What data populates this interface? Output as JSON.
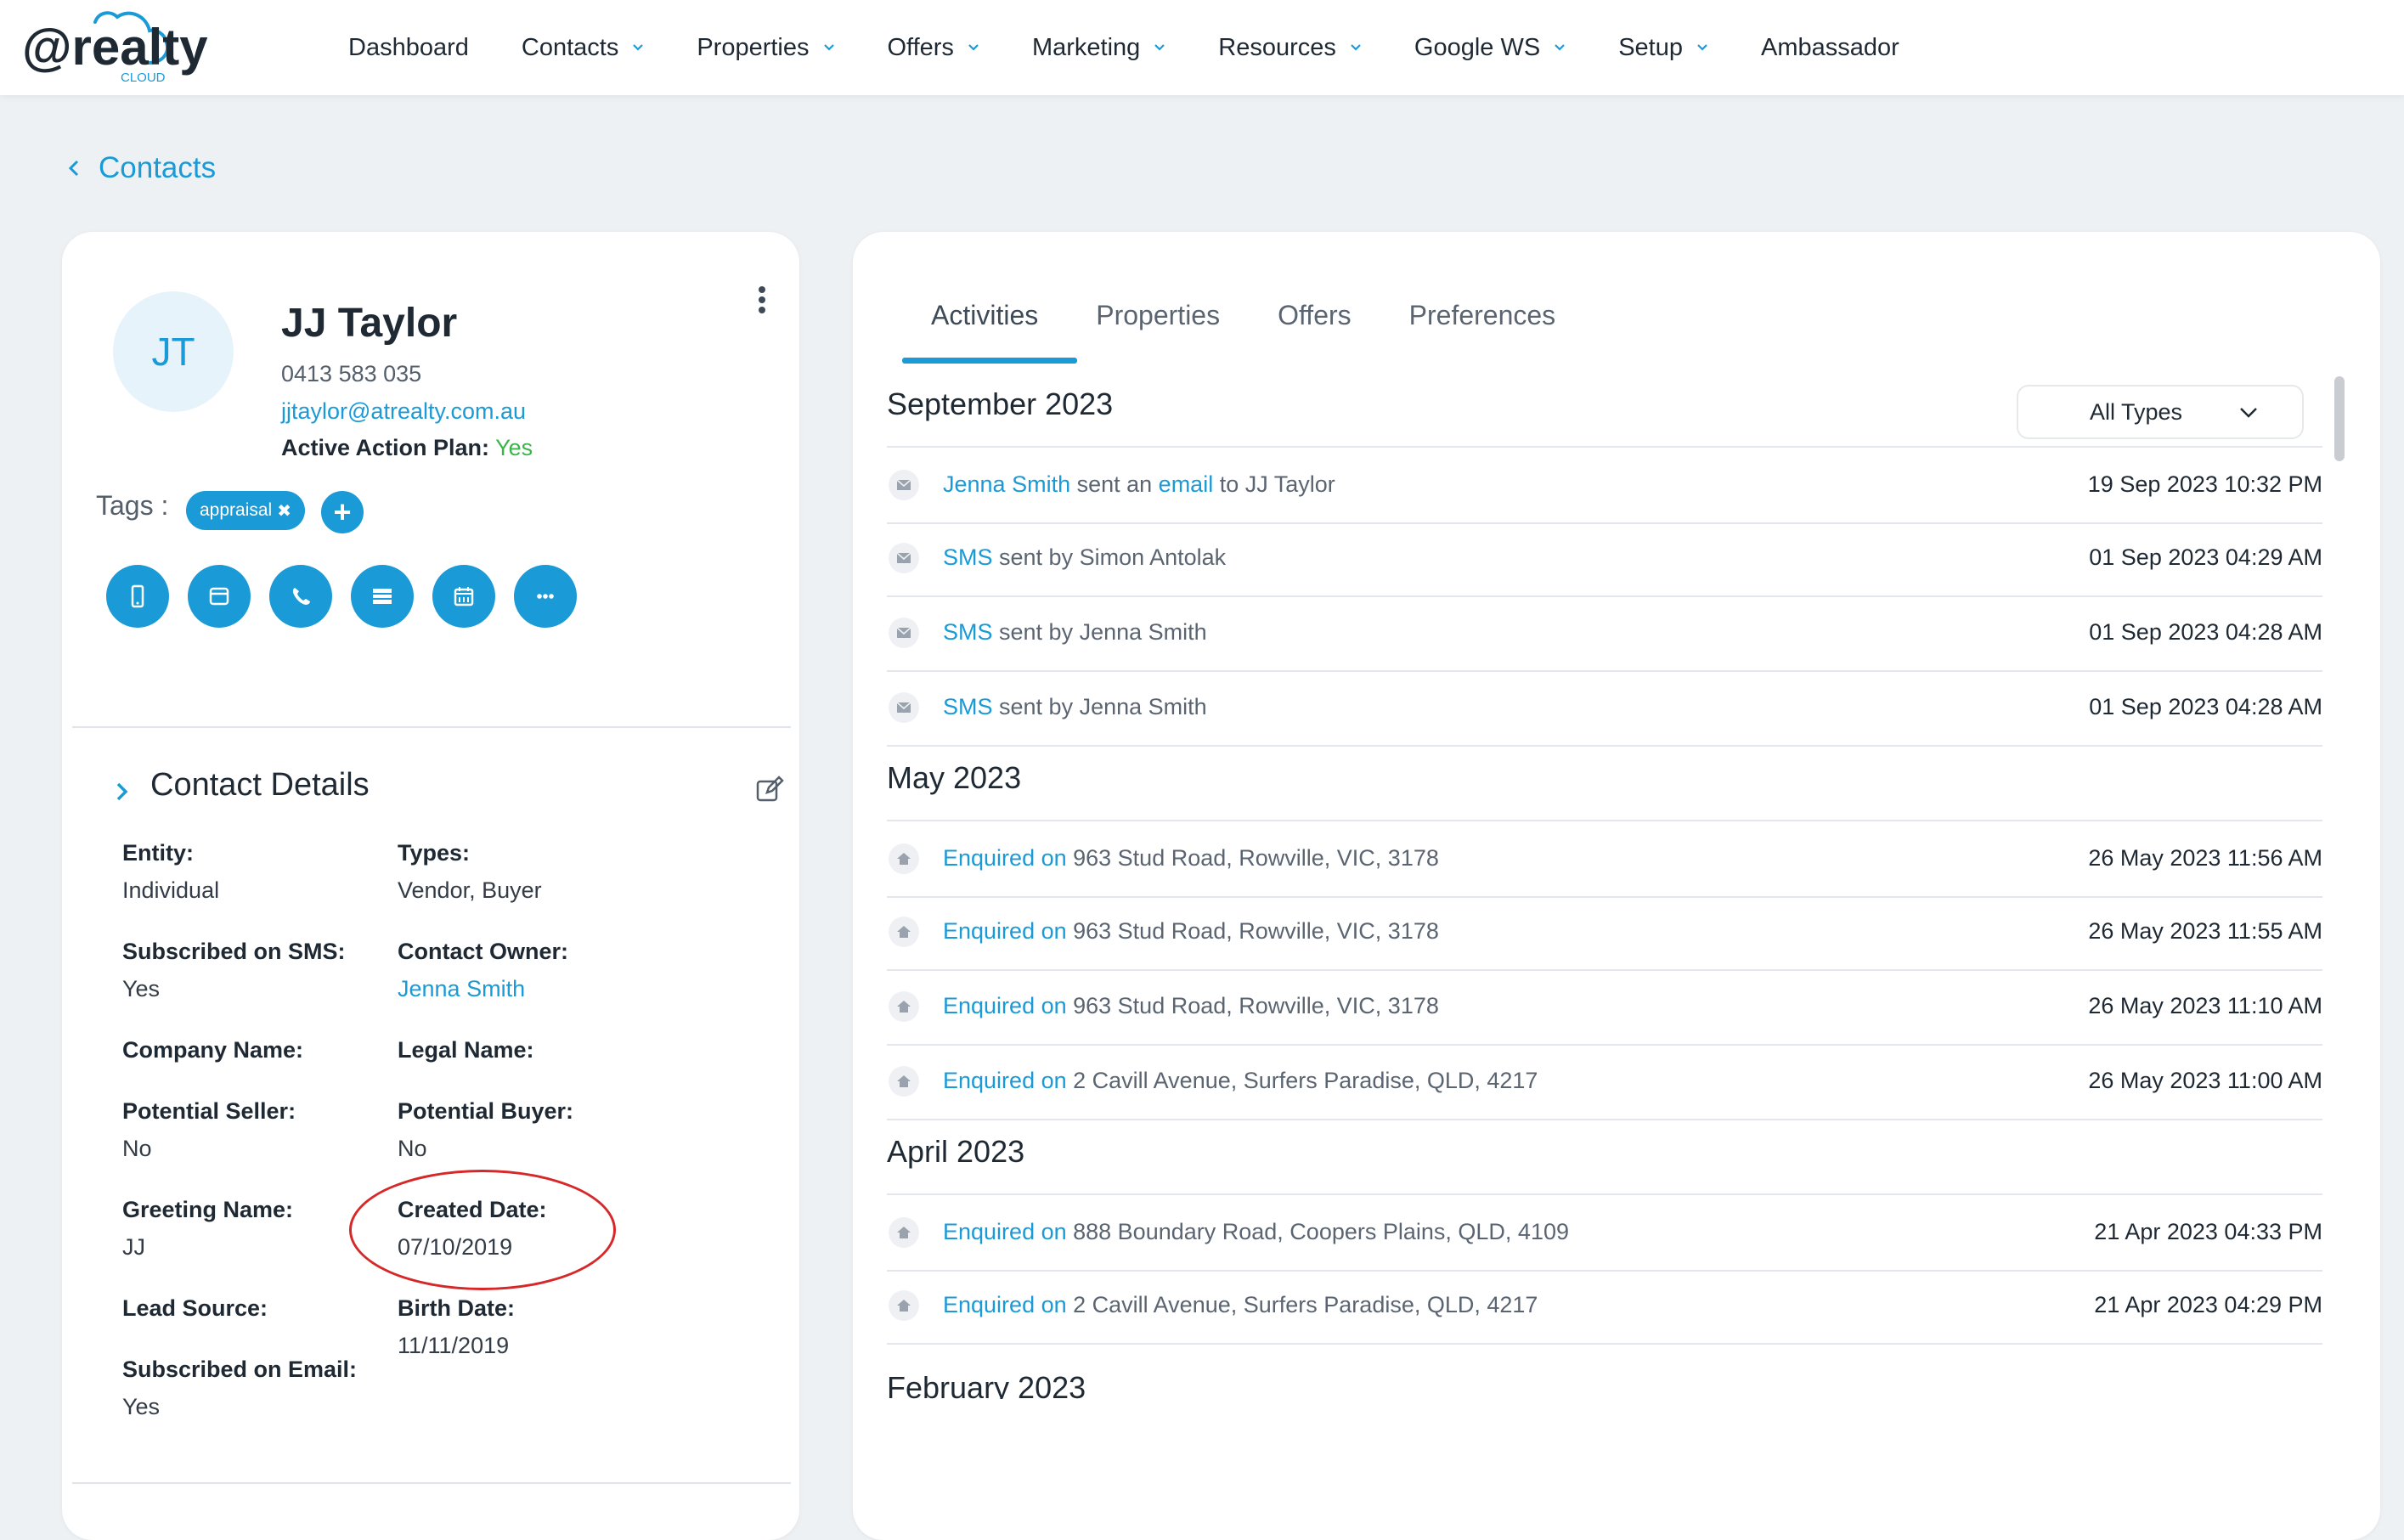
{
  "brand": {
    "logo_at": "@realty",
    "logo_sub": "CLOUD",
    "accent": "#1a9ad6"
  },
  "nav": [
    {
      "label": "Dashboard",
      "dropdown": false
    },
    {
      "label": "Contacts",
      "dropdown": true
    },
    {
      "label": "Properties",
      "dropdown": true
    },
    {
      "label": "Offers",
      "dropdown": true
    },
    {
      "label": "Marketing",
      "dropdown": true
    },
    {
      "label": "Resources",
      "dropdown": true
    },
    {
      "label": "Google WS",
      "dropdown": true
    },
    {
      "label": "Setup",
      "dropdown": true
    },
    {
      "label": "Ambassador",
      "dropdown": false
    }
  ],
  "back_link": "Contacts",
  "contact": {
    "initials": "JT",
    "name": "JJ Taylor",
    "phone": "0413 583 035",
    "email": "jjtaylor@atrealty.com.au",
    "action_plan_label": "Active Action Plan:",
    "action_plan_value": "Yes",
    "tags_label": "Tags :",
    "tags": [
      "appraisal"
    ],
    "add_tag": "+"
  },
  "contact_details": {
    "title": "Contact Details",
    "fields": {
      "entity": {
        "label": "Entity:",
        "value": "Individual"
      },
      "types": {
        "label": "Types:",
        "value": "Vendor, Buyer"
      },
      "sms": {
        "label": "Subscribed on SMS:",
        "value": "Yes"
      },
      "owner": {
        "label": "Contact Owner:",
        "value": "Jenna Smith"
      },
      "company": {
        "label": "Company Name:",
        "value": ""
      },
      "legal": {
        "label": "Legal Name:",
        "value": ""
      },
      "seller": {
        "label": "Potential Seller:",
        "value": "No"
      },
      "buyer": {
        "label": "Potential Buyer:",
        "value": "No"
      },
      "greeting": {
        "label": "Greeting Name:",
        "value": "JJ"
      },
      "created": {
        "label": "Created Date:",
        "value": "07/10/2019"
      },
      "lead": {
        "label": "Lead Source:",
        "value": ""
      },
      "birth": {
        "label": "Birth Date:",
        "value": "11/11/2019"
      },
      "email_sub": {
        "label": "Subscribed on Email:",
        "value": "Yes"
      }
    }
  },
  "tabs": [
    "Activities",
    "Properties",
    "Offers",
    "Preferences"
  ],
  "filter": {
    "selected": "All Types"
  },
  "activities": {
    "months": [
      "September 2023",
      "May 2023",
      "April 2023",
      "February 2023"
    ],
    "rows": [
      {
        "p1": "Jenna Smith",
        "p2": " sent an ",
        "p3": "email",
        "p4": " to JJ Taylor",
        "time": "19 Sep 2023 10:32 PM"
      },
      {
        "p1": "SMS",
        "p2": " sent by Simon Antolak",
        "time": "01 Sep 2023 04:29 AM"
      },
      {
        "p1": "SMS",
        "p2": " sent by Jenna Smith",
        "time": "01 Sep 2023 04:28 AM"
      },
      {
        "p1": "SMS",
        "p2": " sent by Jenna Smith",
        "time": "01 Sep 2023 04:28 AM"
      },
      {
        "p1": "Enquired on",
        "p2": " 963 Stud Road, Rowville, VIC, 3178",
        "time": "26 May 2023 11:56 AM"
      },
      {
        "p1": "Enquired on",
        "p2": " 963 Stud Road, Rowville, VIC, 3178",
        "time": "26 May 2023 11:55 AM"
      },
      {
        "p1": "Enquired on",
        "p2": " 963 Stud Road, Rowville, VIC, 3178",
        "time": "26 May 2023 11:10 AM"
      },
      {
        "p1": "Enquired on",
        "p2": " 2 Cavill Avenue, Surfers Paradise, QLD, 4217",
        "time": "26 May 2023 11:00 AM"
      },
      {
        "p1": "Enquired on",
        "p2": " 888 Boundary Road, Coopers Plains, QLD, 4109",
        "time": "21 Apr 2023 04:33 PM"
      },
      {
        "p1": "Enquired on",
        "p2": " 2 Cavill Avenue, Surfers Paradise, QLD, 4217",
        "time": "21 Apr 2023 04:29 PM"
      }
    ]
  }
}
